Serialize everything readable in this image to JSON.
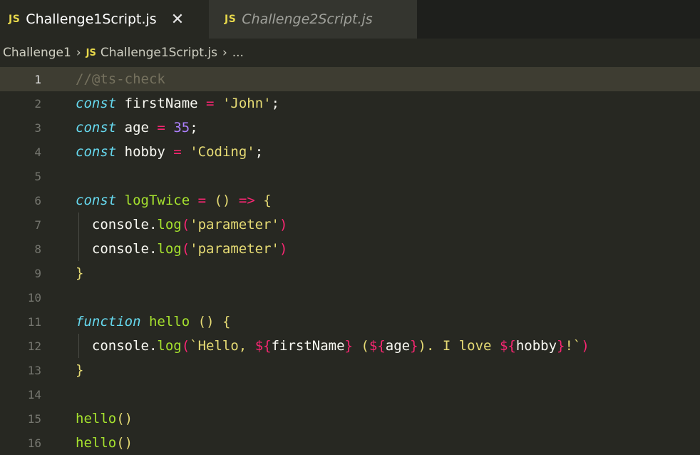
{
  "tabs": [
    {
      "badge": "JS",
      "label": "Challenge1Script.js",
      "close": "✕",
      "active": true
    },
    {
      "badge": "JS",
      "label": "Challenge2Script.js",
      "active": false
    }
  ],
  "breadcrumb": {
    "folder": "Challenge1",
    "sep1": "›",
    "badge": "JS",
    "file": "Challenge1Script.js",
    "sep2": "›",
    "more": "..."
  },
  "editor": {
    "current_line": 1,
    "lines": [
      {
        "n": "1",
        "tokens": [
          [
            "cm",
            "//@ts-check"
          ]
        ]
      },
      {
        "n": "2",
        "tokens": [
          [
            "kw",
            "const"
          ],
          [
            "punc",
            " firstName "
          ],
          [
            "op",
            "="
          ],
          [
            "punc",
            " "
          ],
          [
            "str",
            "'John'"
          ],
          [
            "punc",
            ";"
          ]
        ]
      },
      {
        "n": "3",
        "tokens": [
          [
            "kw",
            "const"
          ],
          [
            "punc",
            " age "
          ],
          [
            "op",
            "="
          ],
          [
            "punc",
            " "
          ],
          [
            "num",
            "35"
          ],
          [
            "punc",
            ";"
          ]
        ]
      },
      {
        "n": "4",
        "tokens": [
          [
            "kw",
            "const"
          ],
          [
            "punc",
            " hobby "
          ],
          [
            "op",
            "="
          ],
          [
            "punc",
            " "
          ],
          [
            "str",
            "'Coding'"
          ],
          [
            "punc",
            ";"
          ]
        ]
      },
      {
        "n": "5",
        "tokens": []
      },
      {
        "n": "6",
        "tokens": [
          [
            "kw",
            "const"
          ],
          [
            "punc",
            " "
          ],
          [
            "fn",
            "logTwice"
          ],
          [
            "punc",
            " "
          ],
          [
            "op",
            "="
          ],
          [
            "punc",
            " "
          ],
          [
            "brace",
            "()"
          ],
          [
            "punc",
            " "
          ],
          [
            "op",
            "=>"
          ],
          [
            "punc",
            " "
          ],
          [
            "brace",
            "{"
          ]
        ]
      },
      {
        "n": "7",
        "tokens": [
          [
            "punc",
            "  console."
          ],
          [
            "fn",
            "log"
          ],
          [
            "op",
            "("
          ],
          [
            "str",
            "'parameter'"
          ],
          [
            "op",
            ")"
          ]
        ]
      },
      {
        "n": "8",
        "tokens": [
          [
            "punc",
            "  console."
          ],
          [
            "fn",
            "log"
          ],
          [
            "op",
            "("
          ],
          [
            "str",
            "'parameter'"
          ],
          [
            "op",
            ")"
          ]
        ]
      },
      {
        "n": "9",
        "tokens": [
          [
            "brace",
            "}"
          ]
        ]
      },
      {
        "n": "10",
        "tokens": []
      },
      {
        "n": "11",
        "tokens": [
          [
            "kw",
            "function"
          ],
          [
            "punc",
            " "
          ],
          [
            "fn",
            "hello"
          ],
          [
            "punc",
            " "
          ],
          [
            "brace",
            "()"
          ],
          [
            "punc",
            " "
          ],
          [
            "brace",
            "{"
          ]
        ]
      },
      {
        "n": "12",
        "tokens": [
          [
            "punc",
            "  console."
          ],
          [
            "fn",
            "log"
          ],
          [
            "op",
            "("
          ],
          [
            "str",
            "`Hello, "
          ],
          [
            "op",
            "${"
          ],
          [
            "punc",
            "firstName"
          ],
          [
            "op",
            "}"
          ],
          [
            "str",
            " ("
          ],
          [
            "op",
            "${"
          ],
          [
            "punc",
            "age"
          ],
          [
            "op",
            "}"
          ],
          [
            "str",
            "). I love "
          ],
          [
            "op",
            "${"
          ],
          [
            "punc",
            "hobby"
          ],
          [
            "op",
            "}"
          ],
          [
            "str",
            "!`"
          ],
          [
            "op",
            ")"
          ]
        ]
      },
      {
        "n": "13",
        "tokens": [
          [
            "brace",
            "}"
          ]
        ]
      },
      {
        "n": "14",
        "tokens": []
      },
      {
        "n": "15",
        "tokens": [
          [
            "fn",
            "hello"
          ],
          [
            "brace",
            "()"
          ]
        ]
      },
      {
        "n": "16",
        "tokens": [
          [
            "fn",
            "hello"
          ],
          [
            "brace",
            "()"
          ]
        ]
      }
    ]
  },
  "colors": {
    "background": "#272822",
    "keyword": "#66d9ef",
    "operator": "#f92672",
    "string": "#e6db74",
    "number": "#ae81ff",
    "function": "#a6e22e",
    "comment": "#75715e",
    "js_badge": "#e7d84b"
  }
}
